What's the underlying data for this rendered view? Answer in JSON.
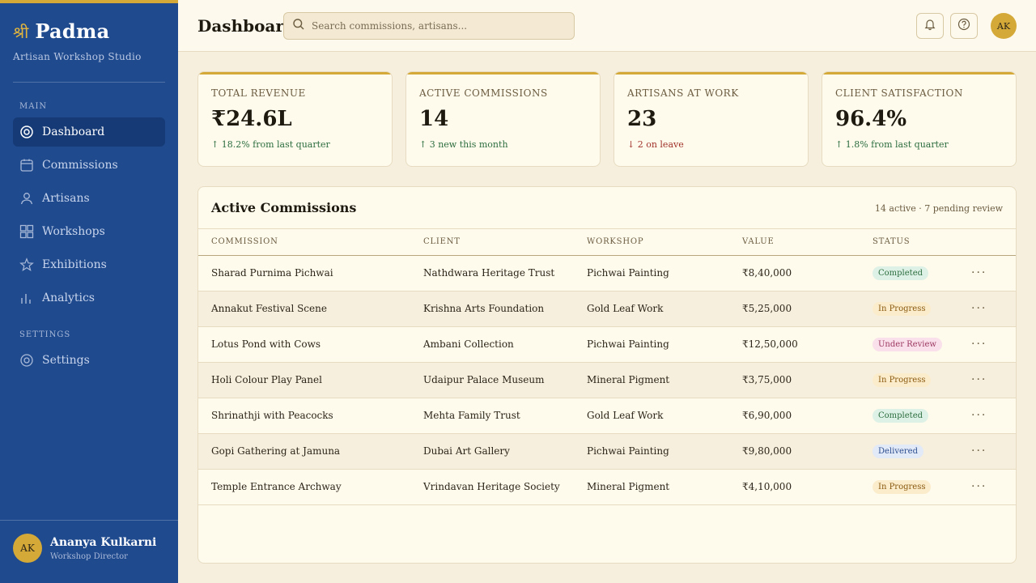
{
  "app": {
    "brand_glyph": "श्री",
    "brand_name": "Padma",
    "brand_subtitle": "Artisan Workshop Studio",
    "accent_color": "#d4a937",
    "sidebar_color": "#1f4a8e"
  },
  "sidebar": {
    "main_section": "MAIN",
    "items": [
      {
        "label": "Dashboard",
        "icon": "dashboard-icon",
        "active": true
      },
      {
        "label": "Commissions",
        "icon": "calendar-icon",
        "active": false
      },
      {
        "label": "Artisans",
        "icon": "user-icon",
        "active": false
      },
      {
        "label": "Workshops",
        "icon": "grid-icon",
        "active": false
      },
      {
        "label": "Exhibitions",
        "icon": "star-icon",
        "active": false
      },
      {
        "label": "Analytics",
        "icon": "bar-chart-icon",
        "active": false
      }
    ],
    "settings_section": "SETTINGS",
    "settings_item": {
      "label": "Settings",
      "icon": "gear-icon"
    },
    "user": {
      "initials": "AK",
      "name": "Ananya Kulkarni",
      "role": "Workshop Director"
    }
  },
  "header": {
    "title": "Dashboard",
    "search_placeholder": "Search commissions, artisans...",
    "user_initials": "AK"
  },
  "stats": [
    {
      "label": "Total Revenue",
      "value": "₹24.6L",
      "delta": "↑ 18.2% from last quarter",
      "trend": "up"
    },
    {
      "label": "Active Commissions",
      "value": "14",
      "delta": "↑ 3 new this month",
      "trend": "up"
    },
    {
      "label": "Artisans at Work",
      "value": "23",
      "delta": "↓ 2 on leave",
      "trend": "down"
    },
    {
      "label": "Client Satisfaction",
      "value": "96.4%",
      "delta": "↑ 1.8% from last quarter",
      "trend": "up"
    }
  ],
  "table": {
    "title": "Active Commissions",
    "meta": "14 active · 7 pending review",
    "columns": [
      "Commission",
      "Client",
      "Workshop",
      "Value",
      "Status"
    ],
    "rows": [
      {
        "commission": "Sharad Purnima Pichwai",
        "client": "Nathdwara Heritage Trust",
        "workshop": "Pichwai Painting",
        "value": "₹8,40,000",
        "status": "Completed"
      },
      {
        "commission": "Annakut Festival Scene",
        "client": "Krishna Arts Foundation",
        "workshop": "Gold Leaf Work",
        "value": "₹5,25,000",
        "status": "In Progress"
      },
      {
        "commission": "Lotus Pond with Cows",
        "client": "Ambani Collection",
        "workshop": "Pichwai Painting",
        "value": "₹12,50,000",
        "status": "Under Review"
      },
      {
        "commission": "Holi Colour Play Panel",
        "client": "Udaipur Palace Museum",
        "workshop": "Mineral Pigment",
        "value": "₹3,75,000",
        "status": "In Progress"
      },
      {
        "commission": "Shrinathji with Peacocks",
        "client": "Mehta Family Trust",
        "workshop": "Gold Leaf Work",
        "value": "₹6,90,000",
        "status": "Completed"
      },
      {
        "commission": "Gopi Gathering at Jamuna",
        "client": "Dubai Art Gallery",
        "workshop": "Pichwai Painting",
        "value": "₹9,80,000",
        "status": "Delivered"
      },
      {
        "commission": "Temple Entrance Archway",
        "client": "Vrindavan Heritage Society",
        "workshop": "Mineral Pigment",
        "value": "₹4,10,000",
        "status": "In Progress"
      }
    ],
    "row_action": "···"
  }
}
